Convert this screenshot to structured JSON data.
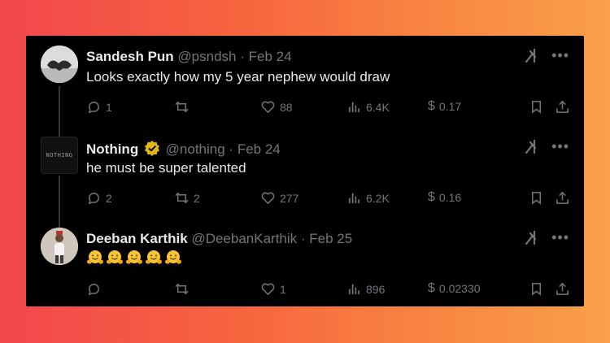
{
  "tweets": [
    {
      "name": "Sandesh Pun",
      "handle": "@psndsh",
      "date": "Feb 24",
      "text": "Looks exactly how my 5 year nephew would draw",
      "replies": "1",
      "reposts": "",
      "likes": "88",
      "views": "6.4K",
      "tips": "0.17"
    },
    {
      "name": "Nothing",
      "handle": "@nothing",
      "date": "Feb 24",
      "text": "he must be super talented",
      "avatar_text": "NOTHING",
      "replies": "2",
      "reposts": "2",
      "likes": "277",
      "views": "6.2K",
      "tips": "0.16"
    },
    {
      "name": "Deeban Karthik",
      "handle": "@DeebanKarthik",
      "date": "Feb 25",
      "emoji_count": 5,
      "replies": "",
      "reposts": "",
      "likes": "1",
      "views": "896",
      "tips": "0.02330"
    }
  ],
  "separator": " · ",
  "currency": "$",
  "colors": {
    "card_bg": "#000000",
    "name": "#e7e9ea",
    "meta": "#71767b",
    "verified": "#e2b719",
    "background_gradient": [
      "#f2474d",
      "#f9a04a"
    ]
  },
  "icons": [
    "grok-icon",
    "more-icon",
    "reply-icon",
    "repost-icon",
    "like-icon",
    "views-icon",
    "tip-icon",
    "bookmark-icon",
    "share-icon",
    "verified-badge-icon",
    "hugging-face-emoji"
  ]
}
